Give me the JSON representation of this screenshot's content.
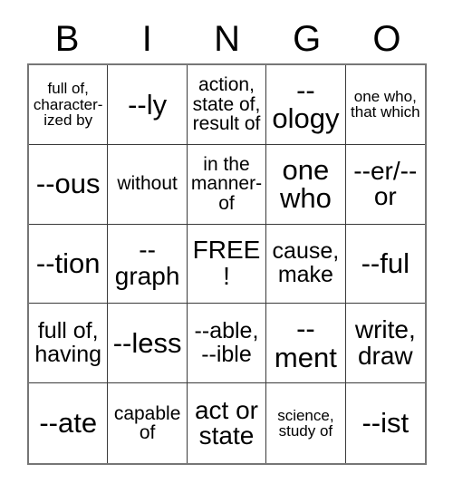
{
  "card": {
    "type": "bingo-card",
    "columns": 5,
    "rows": 5,
    "header": {
      "letters": [
        "B",
        "I",
        "N",
        "G",
        "O"
      ]
    },
    "free_space": {
      "label": "FREE!",
      "row": 3,
      "column": 3
    },
    "cells": [
      [
        {
          "text": "full of, character-ized by",
          "size": "sm"
        },
        {
          "text": "--ly",
          "size": "xxl"
        },
        {
          "text": "action, state of, result of",
          "size": "md"
        },
        {
          "text": "--ology",
          "size": "xxl"
        },
        {
          "text": "one who, that which",
          "size": "sm"
        }
      ],
      [
        {
          "text": "--ous",
          "size": "xxl"
        },
        {
          "text": "without",
          "size": "md"
        },
        {
          "text": "in the manner-of",
          "size": "md"
        },
        {
          "text": "one who",
          "size": "xxl"
        },
        {
          "text": "--er/--or",
          "size": "xl"
        }
      ],
      [
        {
          "text": "--tion",
          "size": "xxl"
        },
        {
          "text": "--graph",
          "size": "xl"
        },
        {
          "text": "FREE!",
          "size": "xl"
        },
        {
          "text": "cause, make",
          "size": "lg"
        },
        {
          "text": "--ful",
          "size": "xxl"
        }
      ],
      [
        {
          "text": "full of, having",
          "size": "lg"
        },
        {
          "text": "--less",
          "size": "xxl"
        },
        {
          "text": "--able, --ible",
          "size": "lg"
        },
        {
          "text": "--ment",
          "size": "xxl"
        },
        {
          "text": "write, draw",
          "size": "xl"
        }
      ],
      [
        {
          "text": "--ate",
          "size": "xxl"
        },
        {
          "text": "capable of",
          "size": "md"
        },
        {
          "text": "act or state",
          "size": "xl"
        },
        {
          "text": "science, study of",
          "size": "sm"
        },
        {
          "text": "--ist",
          "size": "xxl"
        }
      ]
    ]
  },
  "colors": {
    "background": "#ffffff",
    "text": "#000000",
    "grid_line": "#3a3a3a",
    "grid_outer": "#767676"
  }
}
